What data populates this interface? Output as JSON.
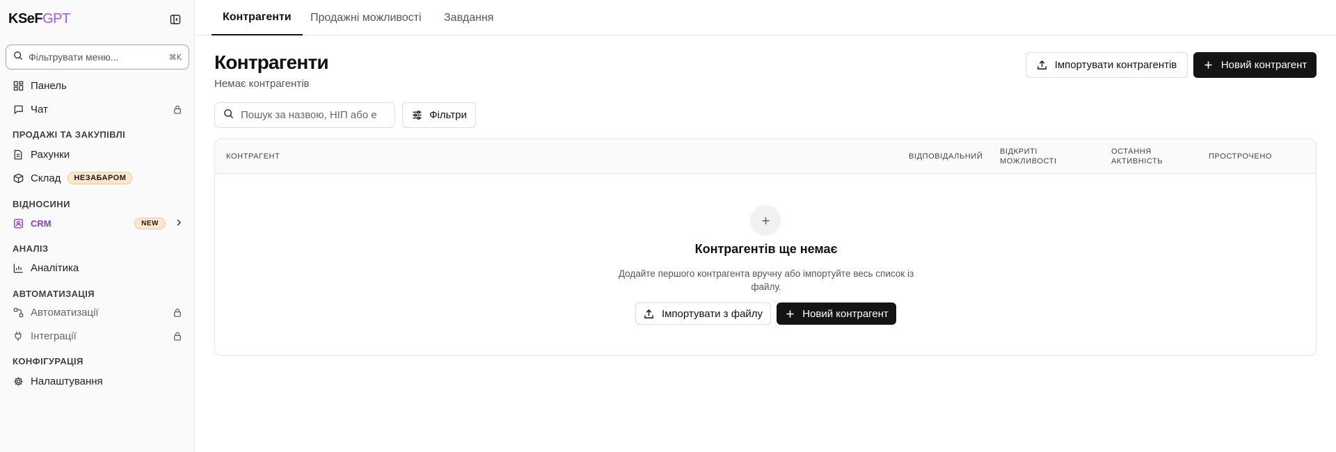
{
  "sidebar": {
    "logo_main": "KSeF",
    "logo_accent": "GPT",
    "filter_placeholder": "Фільтрувати меню...",
    "filter_shortcut": "⌘K",
    "items": {
      "panel": "Панель",
      "chat": "Чат",
      "invoices": "Рахунки",
      "warehouse": "Склад",
      "warehouse_badge": "НЕЗАБАРОМ",
      "crm": "CRM",
      "crm_badge": "NEW",
      "analytics": "Аналітика",
      "automations": "Автоматизації",
      "integrations": "Інтеграції",
      "settings": "Налаштування"
    },
    "sections": {
      "sales": "ПРОДАЖІ ТА ЗАКУПІВЛІ",
      "relations": "ВІДНОСИНИ",
      "analysis": "АНАЛІЗ",
      "automation": "АВТОМАТИЗАЦІЯ",
      "config": "КОНФІГУРАЦІЯ"
    }
  },
  "tabs": [
    "Контрагенти",
    "Продажні можливості",
    "Завдання"
  ],
  "header": {
    "title": "Контрагенти",
    "subtitle": "Немає контрагентів",
    "import_label": "Імпортувати контрагентів",
    "new_label": "Новий контрагент"
  },
  "toolbar": {
    "search_placeholder": "Пошук за назвою, НІП або е",
    "filters_label": "Фільтри"
  },
  "table": {
    "columns": {
      "counterparty": "КОНТРАГЕНТ",
      "responsible": "ВІДПОВІДАЛЬНИЙ",
      "open_opps_1": "ВІДКРИТІ",
      "open_opps_2": "МОЖЛИВОСТІ",
      "last_activity_1": "ОСТАННЯ",
      "last_activity_2": "АКТИВНІСТЬ",
      "overdue": "ПРОСТРОЧЕНО"
    }
  },
  "empty_state": {
    "title": "Контрагентів ще немає",
    "description": "Додайте першого контрагента вручну або імпортуйте весь список із файлу.",
    "import_label": "Імпортувати з файлу",
    "new_label": "Новий контрагент"
  },
  "colors": {
    "accent": "#a855f7",
    "dark_button": "#141414",
    "badge_bg": "#fde8cc"
  }
}
